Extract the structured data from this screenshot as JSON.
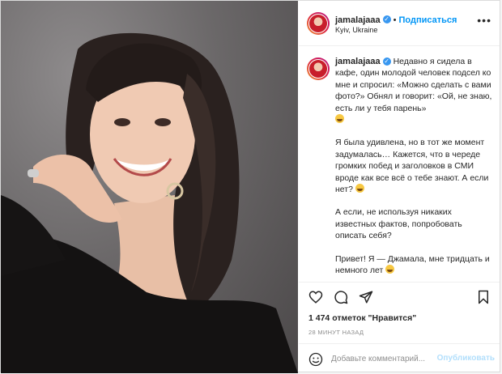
{
  "post": {
    "username": "jamalajaaa",
    "follow_label": "Подписаться",
    "location": "Kyiv, Ukraine",
    "more_label": "•••",
    "caption_username": "jamalajaaa",
    "caption_paragraphs": [
      "Недавно я сидела в кафе, один молодой человек подсел ко мне и спросил: «Можно сделать с вами фото?» Обнял и говорит: «Ой, не знаю, есть ли у тебя парень»",
      "Я была удивлена, но в тот же момент задумалась… Кажется, что в череде громких побед и заголовков в СМИ вроде как все всё о тебе знают. А если нет?",
      "А если, не используя никаких известных фактов, попробовать описать себя?",
      "Привет! Я — Джамала, мне тридцать и немного лет"
    ],
    "likes": "1 474 отметок \"Нравится\"",
    "time": "28 МИНУТ НАЗАД",
    "comment_placeholder": "Добавьте комментарий...",
    "publish_label": "Опубликовать"
  },
  "colors": {
    "accent": "#0095f6",
    "verified": "#3897f0",
    "publish_disabled": "#b2dffc"
  },
  "icons": [
    "verified-badge-icon",
    "more-options-icon",
    "heart-icon",
    "comment-icon",
    "share-icon",
    "bookmark-icon",
    "emoji-icon",
    "laughing-emoji-icon"
  ]
}
